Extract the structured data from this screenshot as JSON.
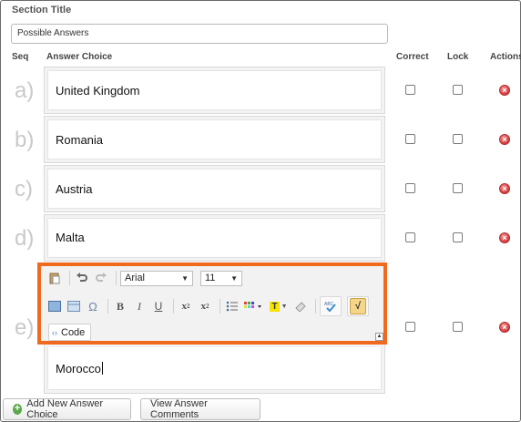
{
  "section": {
    "label": "Section Title",
    "value": "Possible Answers"
  },
  "columns": {
    "seq": "Seq",
    "answer": "Answer Choice",
    "correct": "Correct",
    "lock": "Lock",
    "actions": "Actions"
  },
  "answers": [
    {
      "seq": "a)",
      "text": "United Kingdom",
      "correct": false,
      "lock": false
    },
    {
      "seq": "b)",
      "text": "Romania",
      "correct": false,
      "lock": false
    },
    {
      "seq": "c)",
      "text": "Austria",
      "correct": false,
      "lock": false
    },
    {
      "seq": "d)",
      "text": "Malta",
      "correct": false,
      "lock": false
    },
    {
      "seq": "e)",
      "text": "Morocco",
      "correct": false,
      "lock": false
    }
  ],
  "toolbar": {
    "font_family": "Arial",
    "font_size": "11",
    "code_label": "Code",
    "icons": [
      "paste-icon",
      "undo-icon",
      "redo-icon",
      "insert-image-icon",
      "insert-table-icon",
      "special-character-icon",
      "bold-icon",
      "italic-icon",
      "underline-icon",
      "subscript-icon",
      "superscript-icon",
      "bullet-list-icon",
      "text-color-icon",
      "highlight-icon",
      "eraser-icon",
      "spellcheck-icon",
      "equation-icon"
    ]
  },
  "footer": {
    "add_label": "Add New Answer Choice",
    "comments_label": "View Answer Comments"
  },
  "colors": {
    "highlight": "#ef6a1f",
    "delete": "#d63b3b",
    "add": "#5aa84a"
  }
}
